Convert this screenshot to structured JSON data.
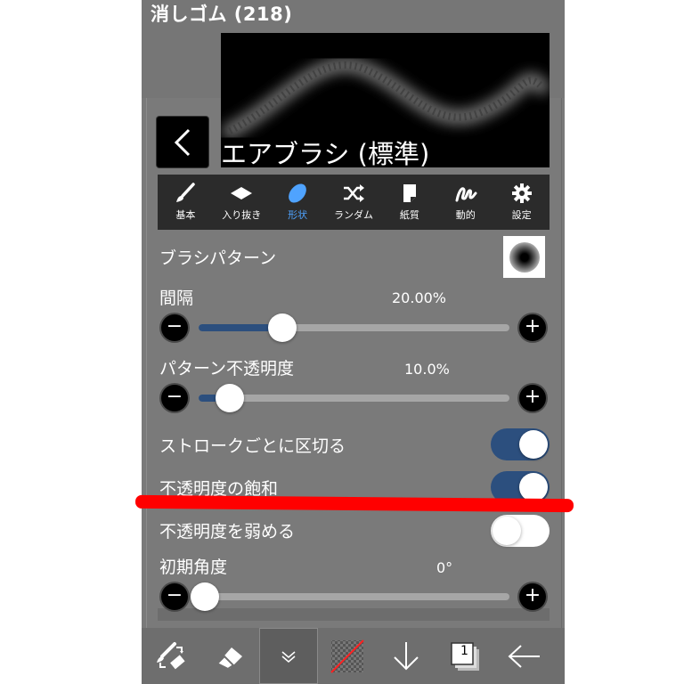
{
  "header": {
    "title": "消しゴム (218)"
  },
  "brush": {
    "name": "エアブラシ (標準)"
  },
  "tabs": [
    {
      "label": "基本",
      "icon": "brush-icon",
      "active": false
    },
    {
      "label": "入り抜き",
      "icon": "diamond-icon",
      "active": false
    },
    {
      "label": "形状",
      "icon": "ellipse-icon",
      "active": true
    },
    {
      "label": "ランダム",
      "icon": "shuffle-icon",
      "active": false
    },
    {
      "label": "紙質",
      "icon": "paper-icon",
      "active": false
    },
    {
      "label": "動的",
      "icon": "dynamic-icon",
      "active": false
    },
    {
      "label": "設定",
      "icon": "gear-icon",
      "active": false
    }
  ],
  "settings": {
    "brush_pattern_label": "ブラシパターン",
    "spacing": {
      "label": "間隔",
      "value": "20.00%",
      "fraction": 0.27
    },
    "pattern_opacity": {
      "label": "パターン不透明度",
      "value": "10.0%",
      "fraction": 0.1
    },
    "per_stroke": {
      "label": "ストロークごとに区切る",
      "on": true
    },
    "opacity_saturation": {
      "label": "不透明度の飽和",
      "on": true
    },
    "weaken_opacity": {
      "label": "不透明度を弱める",
      "on": false
    },
    "initial_angle": {
      "label": "初期角度",
      "value": "0°",
      "fraction": 0.0
    }
  },
  "toolbar": {
    "items": [
      "swap-tool-icon",
      "eraser-icon",
      "chevron-down-icon",
      "color-swatch-icon",
      "arrow-down-icon",
      "layers-icon",
      "arrow-left-icon"
    ],
    "layers_count": "1"
  },
  "colors": {
    "accent": "#2c4f7e",
    "active_tab": "#4fa3ff",
    "annotation": "#ff0000"
  }
}
